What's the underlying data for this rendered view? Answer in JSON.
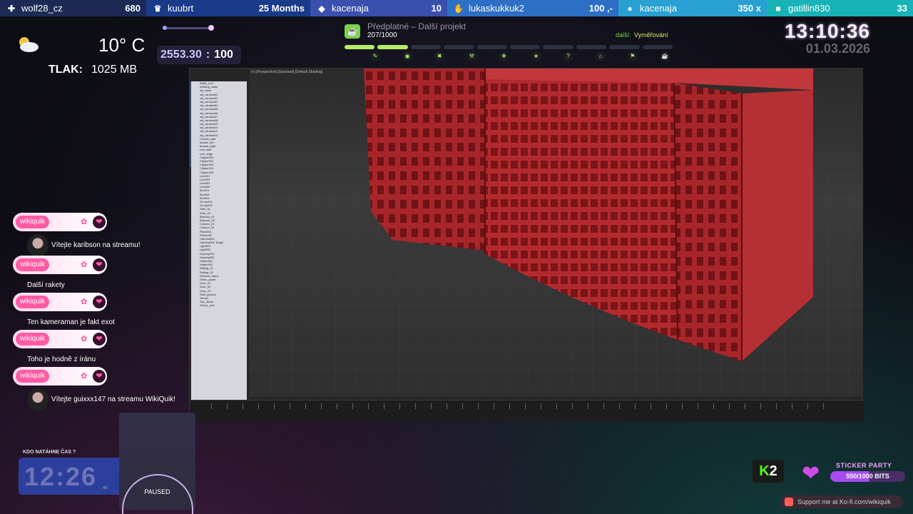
{
  "top_bar": [
    {
      "icon": "add-user-icon",
      "name": "wolf28_cz",
      "value": "680"
    },
    {
      "icon": "crown-icon",
      "name": "kuubrt",
      "value": "25 Months"
    },
    {
      "icon": "diamond-icon",
      "name": "kacenaja",
      "value": "10"
    },
    {
      "icon": "hand-coin-icon",
      "name": "lukaskukkuk2",
      "value": "100 ,-"
    },
    {
      "icon": "coins-icon",
      "name": "kacenaja",
      "value": "350 x"
    },
    {
      "icon": "twitch-icon",
      "name": "gatillin830",
      "value": "33"
    }
  ],
  "weather": {
    "temp": "10° C",
    "pressure_label": "TLAK:",
    "pressure_value": "1025 MB"
  },
  "counter": {
    "current": "2553.30",
    "separator": ":",
    "target": "100"
  },
  "project": {
    "title": "Předplatné – Další projekt",
    "progress_text": "207/1000",
    "progress": 0.207,
    "next_label": "další:",
    "next_value": "Vyměřování"
  },
  "clock": {
    "time": "13:10:36",
    "date": "01.03.2026"
  },
  "viewport": {
    "label": "[+] [Perspective] [Standard] [Default Shading]"
  },
  "scene_tree": [
    "Walls_root",
    "building_walls",
    "obj_base",
    "obj_window01",
    "obj_window02",
    "obj_window03",
    "obj_window04",
    "obj_window05",
    "obj_window06",
    "obj_window07",
    "obj_window08",
    "obj_window09",
    "obj_window10",
    "obj_window11",
    "obj_window12",
    "Curtain_wall",
    "facade_left",
    "facade_right",
    "roof_slab",
    "roof_edge",
    "Clipper001",
    "Clipper002",
    "Clipper003",
    "Clipper004",
    "Clipper005",
    "Line001",
    "Line002",
    "Line003",
    "Line004",
    "Box001",
    "Box002",
    "Box003",
    "Group001",
    "Group002",
    "Stair_01",
    "Stair_02",
    "Balcony_01",
    "Balcony_02",
    "Column_01",
    "Column_02",
    "Plane001",
    "Plane002",
    "Camera001",
    "Camera001.Target",
    "Light001",
    "Light002",
    "Dummy001",
    "Dummy002",
    "Helper001",
    "Helper002",
    "Railing_01",
    "Railing_02",
    "Window_frame",
    "Glass_panel",
    "Door_01",
    "Door_02",
    "Door_03",
    "Slab_ground",
    "Terrain",
    "Sky_dome",
    "Scene_root"
  ],
  "chat": [
    {
      "user": "wikiquik",
      "text": "Vítejte karibson na streamu!",
      "avatar": true
    },
    {
      "user": "wikiquik",
      "text": "Další rakety",
      "avatar": false
    },
    {
      "user": "wikiquik",
      "text": "Ten kameraman je fakt exot",
      "avatar": false
    },
    {
      "user": "wikiquik",
      "text": "Toho je hodně z íránu",
      "avatar": false
    },
    {
      "user": "wikiquik",
      "text": "Vítejte guixxx147 na streamu WikiQuik!",
      "avatar": true
    }
  ],
  "kdo": {
    "label": "KDO NATÁHNE ČAS ?",
    "time": "12:26",
    "tag": "40"
  },
  "paused": {
    "label": "PAUSED"
  },
  "k2": {
    "k": "K",
    "two": "2"
  },
  "sticker": {
    "title": "STICKER PARTY",
    "progress_text": "550/1000 BITS",
    "progress": 0.55
  },
  "kofi": {
    "text": "Support me at Ko-fi.com/wikiquik"
  }
}
